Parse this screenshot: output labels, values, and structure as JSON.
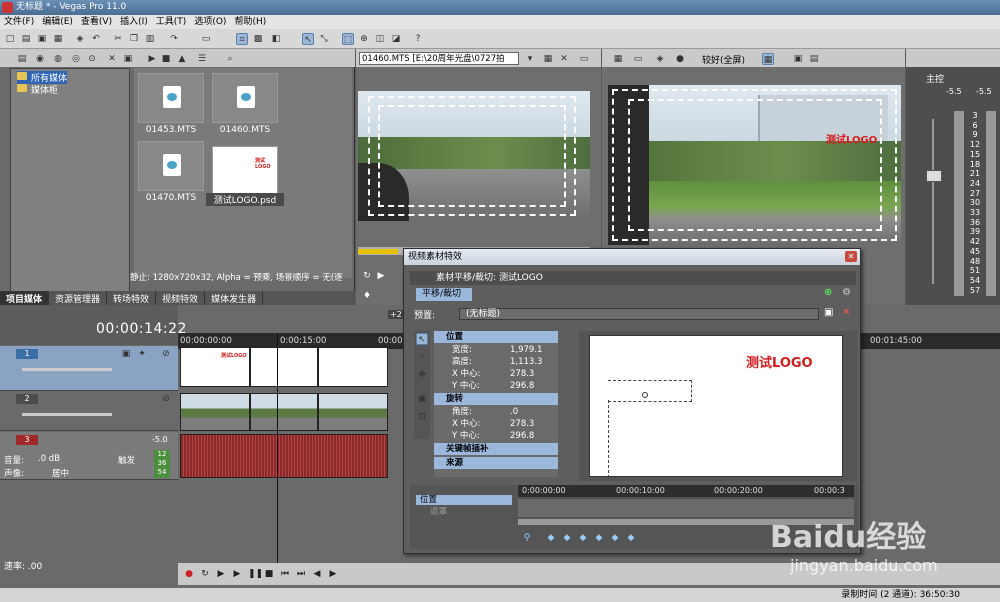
{
  "window": {
    "title": "无标题 * - Vegas Pro 11.0"
  },
  "menu": [
    "文件(F)",
    "编辑(E)",
    "查看(V)",
    "插入(I)",
    "工具(T)",
    "选项(O)",
    "帮助(H)"
  ],
  "explorer": {
    "tree": [
      {
        "label": "所有媒体"
      },
      {
        "label": "媒体柜"
      }
    ],
    "files": [
      "01453.MTS",
      "01460.MTS",
      "01470.MTS",
      "测试LOGO.psd"
    ],
    "thumb_logo_text": "测试LOGO",
    "status": "静止: 1280x720x32,  Alpha = 预乘,  场景顺序 = 无(逐",
    "tabs": [
      "项目媒体",
      "资源管理器",
      "转场特效",
      "视频特效",
      "媒体发生器"
    ]
  },
  "trimmer": {
    "file": "01460.MTS",
    "path": "[E:\\20周年光盘\\0727拍"
  },
  "preview": {
    "quality": "较好(全屏)",
    "logo_text": "测试LOGO"
  },
  "master": {
    "label": "主控",
    "db_top": "-5.5",
    "db_top2": "-5.5",
    "scale": [
      "3",
      "6",
      "9",
      "12",
      "15",
      "18",
      "21",
      "24",
      "27",
      "30",
      "33",
      "36",
      "39",
      "42",
      "45",
      "48",
      "51",
      "54",
      "57"
    ]
  },
  "timeline": {
    "timecode": "00:00:14:22",
    "ruler": [
      "00:00:00:00",
      "0:00:15:00",
      "00:00:3",
      "00:01:45:00"
    ],
    "tracks": [
      {
        "num": "1"
      },
      {
        "num": "2"
      },
      {
        "num": "3",
        "vol_label": "音量:",
        "vol_value": ".0 dB",
        "pan_label": "声像:",
        "pan_value": "居中",
        "mode": "触发",
        "db": "-5.0",
        "meters": [
          "12",
          "36",
          "54"
        ]
      }
    ],
    "plus2": "+2",
    "rate_label": "速率: .00"
  },
  "fx": {
    "title": "视频素材特效",
    "header": "素材平移/裁切:",
    "header_value": "测试LOGO",
    "tab": "平移/裁切",
    "preset_label": "预置:",
    "preset_value": "(无标题)",
    "groups": [
      {
        "name": "位置",
        "rows": [
          {
            "k": "宽度:",
            "v": "1,979.1"
          },
          {
            "k": "高度:",
            "v": "1,113.3"
          },
          {
            "k": "X 中心:",
            "v": "278.3"
          },
          {
            "k": "Y 中心:",
            "v": "296.8"
          }
        ]
      },
      {
        "name": "旋转",
        "rows": [
          {
            "k": "角度:",
            "v": ".0"
          },
          {
            "k": "X 中心:",
            "v": "278.3"
          },
          {
            "k": "Y 中心:",
            "v": "296.8"
          }
        ]
      },
      {
        "name": "关键帧插补",
        "rows": []
      },
      {
        "name": "来源",
        "rows": []
      }
    ],
    "canvas_logo": "测试LOGO",
    "kf_labels": [
      "位置",
      "遮罩"
    ],
    "kf_ruler": [
      "0:00:00:00",
      "00:00:10:00",
      "00:00:20:00",
      "00:00:3"
    ]
  },
  "statusbar": {
    "text": "录制时间 (2 通道): 36:50:30"
  },
  "watermark": {
    "brand": "Baidu经验",
    "url": "jingyan.baidu.com"
  }
}
